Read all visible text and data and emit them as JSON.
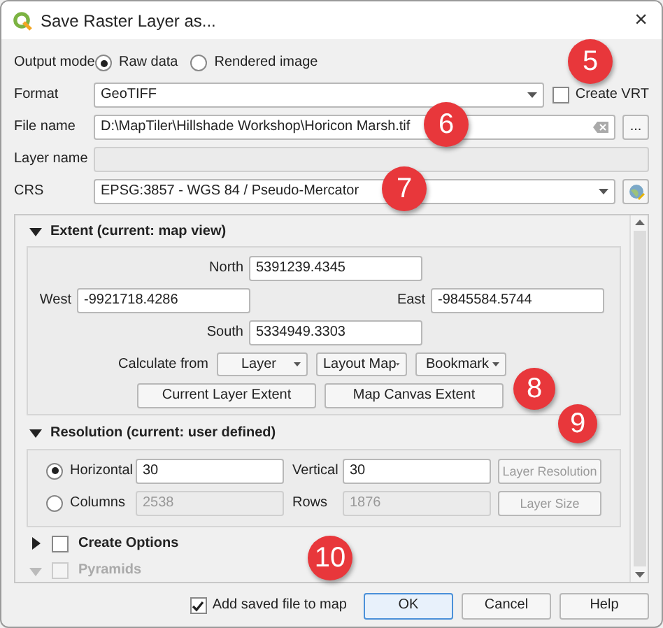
{
  "window": {
    "title": "Save Raster Layer as...",
    "close": "×"
  },
  "output_mode": {
    "label": "Output mode",
    "options": [
      {
        "label": "Raw data",
        "selected": true
      },
      {
        "label": "Rendered image",
        "selected": false
      }
    ]
  },
  "format": {
    "label": "Format",
    "value": "GeoTIFF",
    "create_vrt": {
      "label": "Create VRT",
      "checked": false
    }
  },
  "file_name": {
    "label": "File name",
    "value": "D:\\MapTiler\\Hillshade Workshop\\Horicon Marsh.tif",
    "browse": "..."
  },
  "layer_name": {
    "label": "Layer name",
    "disabled": true
  },
  "crs": {
    "label": "CRS",
    "value": "EPSG:3857 - WGS 84 / Pseudo-Mercator"
  },
  "extent": {
    "title": "Extent (current: map view)",
    "expanded": true,
    "north": {
      "label": "North",
      "value": "5391239.4345"
    },
    "west": {
      "label": "West",
      "value": "-9921718.4286"
    },
    "east": {
      "label": "East",
      "value": "-9845584.5744"
    },
    "south": {
      "label": "South",
      "value": "5334949.3303"
    },
    "calculate_from": {
      "label": "Calculate from",
      "menus": [
        "Layer",
        "Layout Map",
        "Bookmark"
      ]
    },
    "buttons": [
      "Current Layer Extent",
      "Map Canvas Extent"
    ]
  },
  "resolution": {
    "title": "Resolution (current: user defined)",
    "expanded": true,
    "modes": [
      {
        "label": "Horizontal",
        "selected": true,
        "value": "30",
        "second_label": "Vertical",
        "second_value": "30",
        "button": "Layer Resolution",
        "button_disabled": true
      },
      {
        "label": "Columns",
        "selected": false,
        "value": "2538",
        "second_label": "Rows",
        "second_value": "1876",
        "button": "Layer Size",
        "button_disabled": true
      }
    ]
  },
  "sections": [
    {
      "title": "Create Options",
      "expanded": false,
      "checked": false,
      "disabled": false
    },
    {
      "title": "Pyramids",
      "expanded": true,
      "checked": false,
      "disabled": true
    }
  ],
  "footer": {
    "add_to_map": {
      "label": "Add saved file to map",
      "checked": true
    },
    "buttons": [
      {
        "label": "OK",
        "default": true
      },
      {
        "label": "Cancel",
        "default": false
      },
      {
        "label": "Help",
        "default": false
      }
    ]
  },
  "annotations": [
    "5",
    "6",
    "7",
    "8",
    "9",
    "10"
  ]
}
